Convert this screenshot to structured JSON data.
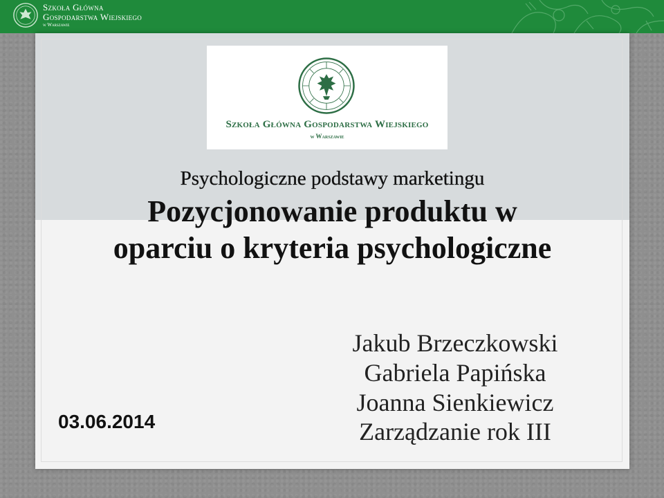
{
  "header": {
    "institution_line1": "Szkoła Główna",
    "institution_line2": "Gospodarstwa Wiejskiego",
    "institution_line3": "w Warszawie"
  },
  "logo": {
    "name": "Szkoła Główna Gospodarstwa Wiejskiego",
    "subname": "w Warszawie"
  },
  "slide": {
    "subtitle": "Psychologiczne podstawy marketingu",
    "title_line1": "Pozycjonowanie produktu w",
    "title_line2": "oparciu o kryteria psychologiczne",
    "date": "03.06.2014",
    "authors": [
      "Jakub Brzeczkowski",
      "Gabriela Papińska",
      "Joanna Sienkiewicz",
      "Zarządzanie rok III"
    ]
  },
  "colors": {
    "banner": "#1f8a3b",
    "logo_text": "#2d6e45",
    "upper_panel": "#d7dbdd",
    "slide_background": "#f3f3f3"
  }
}
